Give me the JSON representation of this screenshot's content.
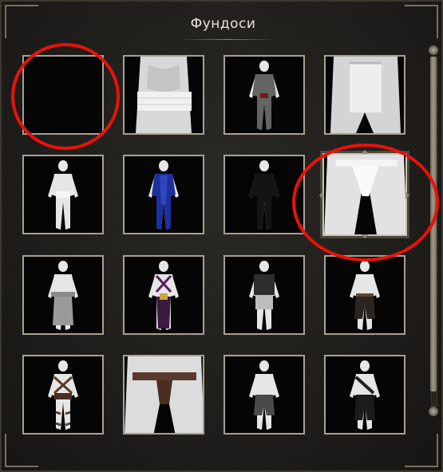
{
  "window": {
    "title": "Фундоси"
  },
  "items": [
    {
      "id": "empty",
      "icon": "empty-slot-icon"
    },
    {
      "id": "white-sash",
      "icon": "white-sash-torso-icon"
    },
    {
      "id": "chainmail-bodysuit",
      "icon": "chainmail-bodysuit-icon"
    },
    {
      "id": "white-apron-front",
      "icon": "apron-icon"
    },
    {
      "id": "white-loincloth-figure",
      "icon": "white-loincloth-figure-icon"
    },
    {
      "id": "blue-bodysuit",
      "icon": "blue-bodysuit-icon"
    },
    {
      "id": "black-bodysuit",
      "icon": "black-bodysuit-icon"
    },
    {
      "id": "fundoshi-closeup",
      "icon": "fundoshi-icon"
    },
    {
      "id": "grey-apron-figure",
      "icon": "grey-apron-figure-icon"
    },
    {
      "id": "purple-harness",
      "icon": "purple-harness-icon"
    },
    {
      "id": "dark-vest-shorts",
      "icon": "dark-vest-shorts-icon"
    },
    {
      "id": "brown-pants",
      "icon": "brown-pants-icon"
    },
    {
      "id": "leather-straps",
      "icon": "leather-straps-icon"
    },
    {
      "id": "leather-belt-pouch",
      "icon": "leather-belt-pouch-icon"
    },
    {
      "id": "grey-shorts",
      "icon": "grey-shorts-icon"
    },
    {
      "id": "black-wrap-shorts",
      "icon": "black-wrap-shorts-icon"
    }
  ],
  "selected_index": 7,
  "colors": {
    "annotation": "#e8120a",
    "tile_border": "#a7a192",
    "panel_bg": "#1e1c19",
    "title_text": "#e9e4d6"
  }
}
